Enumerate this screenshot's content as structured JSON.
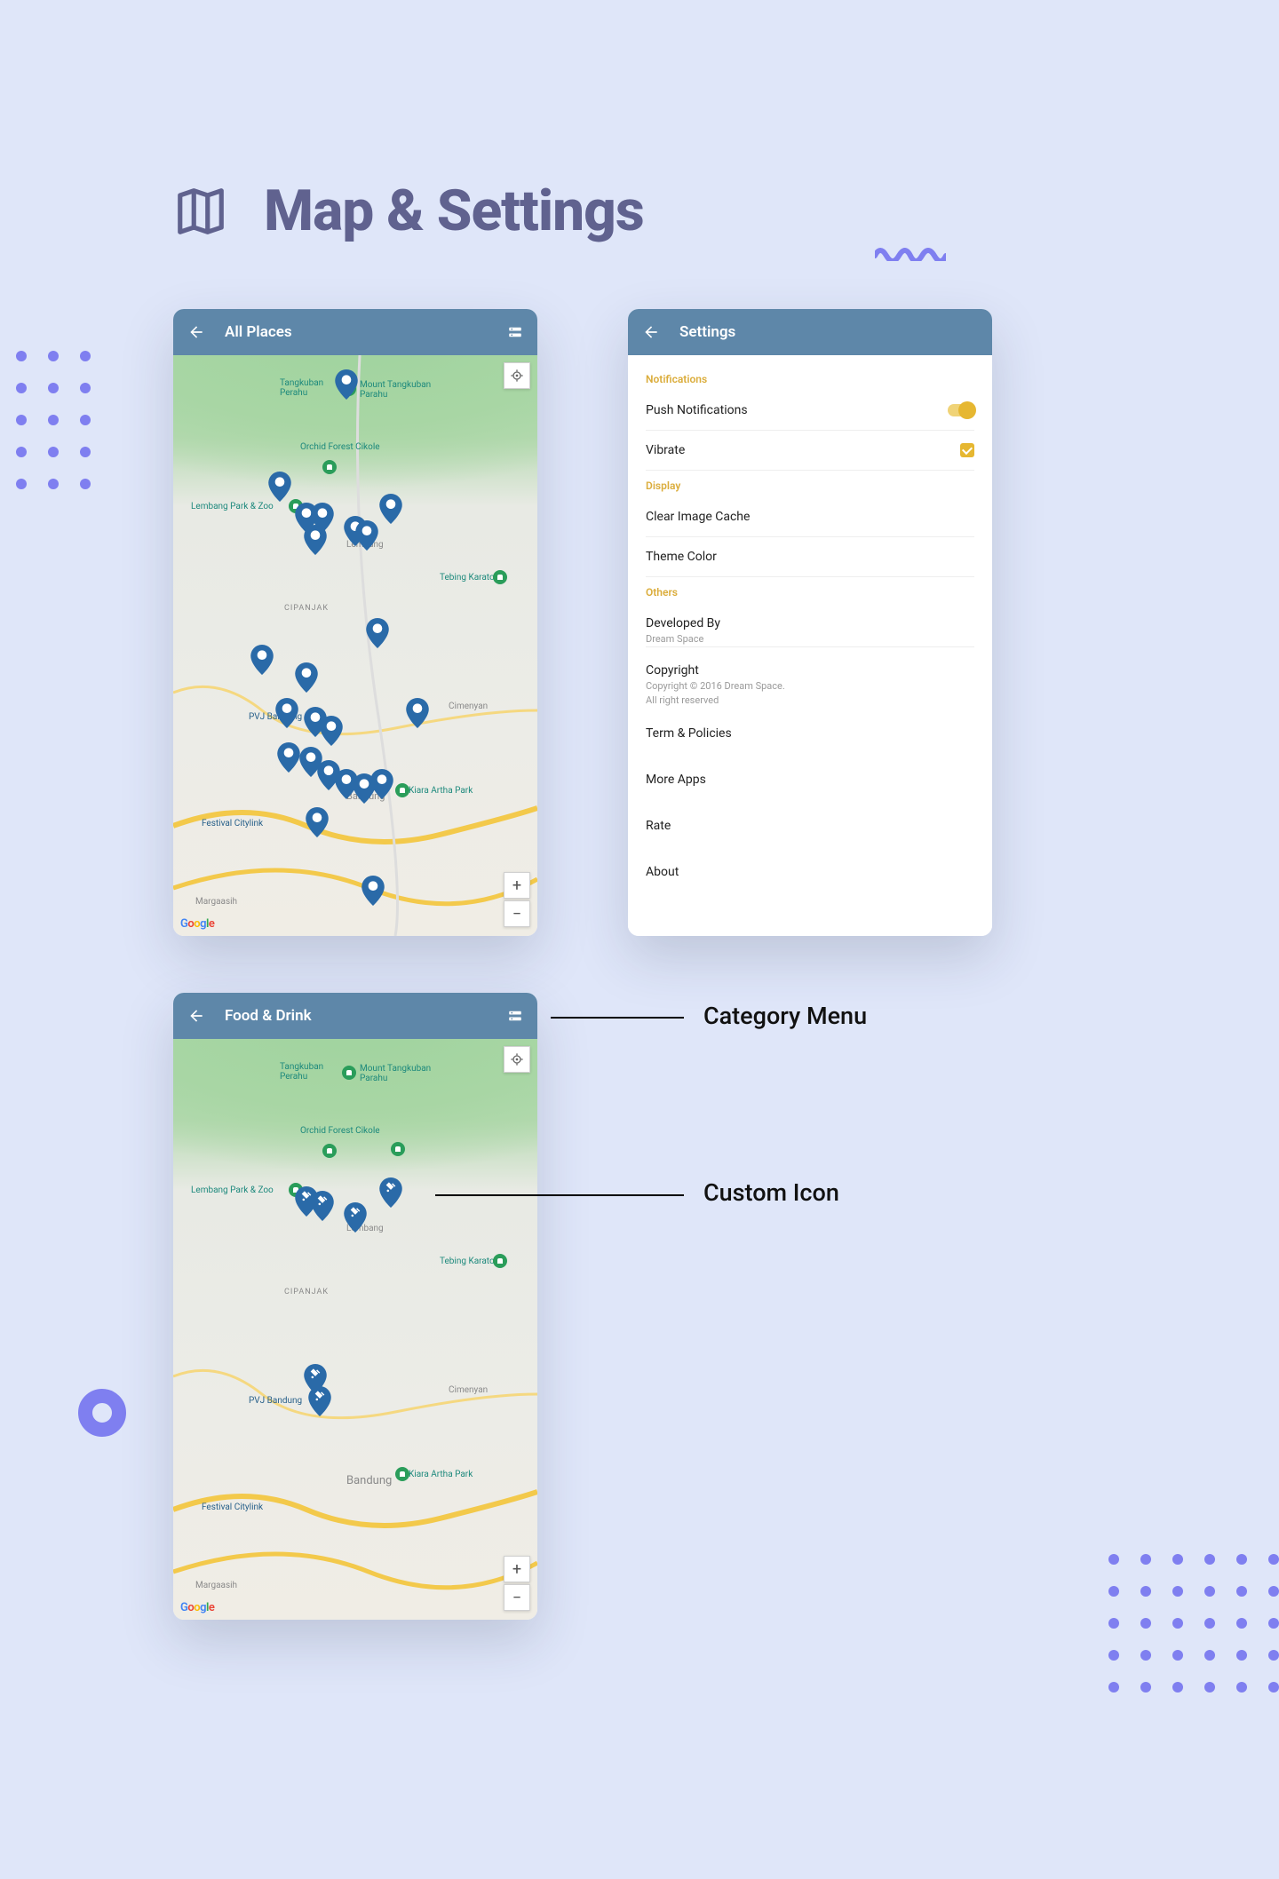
{
  "heading": {
    "title": "Map & Settings"
  },
  "phone_allplaces": {
    "title": "All Places",
    "map_labels": {
      "tangkuban": "Tangkuban\nPerahu",
      "mount": "Mount Tangkuban\nParahu",
      "orchid": "Orchid Forest Cikole",
      "lembang": "Lembang Park & Zoo",
      "lembang_city": "Lembang",
      "tebing": "Tebing Karaton",
      "cipanjak": "CIPANJAK",
      "pvj": "PVJ Bandung",
      "cimenyan": "Cimenyan",
      "kiara": "Kiara Artha Park",
      "festival": "Festival Citylink",
      "margaasih": "Margaasih",
      "bandung": "Bandung"
    }
  },
  "phone_food": {
    "title": "Food & Drink",
    "map_labels": {
      "tangkuban": "Tangkuban\nPerahu",
      "mount": "Mount Tangkuban\nParahu",
      "orchid": "Orchid Forest Cikole",
      "lembang": "Lembang Park & Zoo",
      "lembang_city": "Lembang",
      "tebing": "Tebing Karaton",
      "cipanjak": "CIPANJAK",
      "pvj": "PVJ Bandung",
      "cimenyan": "Cimenyan",
      "kiara": "Kiara Artha Park",
      "festival": "Festival Citylink",
      "margaasih": "Margaasih",
      "bandung": "Bandung"
    }
  },
  "phone_settings": {
    "title": "Settings",
    "sections": {
      "notifications": "Notifications",
      "display": "Display",
      "others": "Others"
    },
    "items": {
      "push": "Push Notifications",
      "vibrate": "Vibrate",
      "clear_cache": "Clear Image Cache",
      "theme": "Theme Color",
      "developed": "Developed By",
      "developed_sub": "Dream Space",
      "copyright": "Copyright",
      "copyright_sub1": "Copyright © 2016 Dream Space.",
      "copyright_sub2": "All right reserved",
      "terms": "Term & Policies",
      "more": "More Apps",
      "rate": "Rate",
      "about": "About"
    }
  },
  "callouts": {
    "category_menu": "Category Menu",
    "custom_icon": "Custom Icon"
  }
}
